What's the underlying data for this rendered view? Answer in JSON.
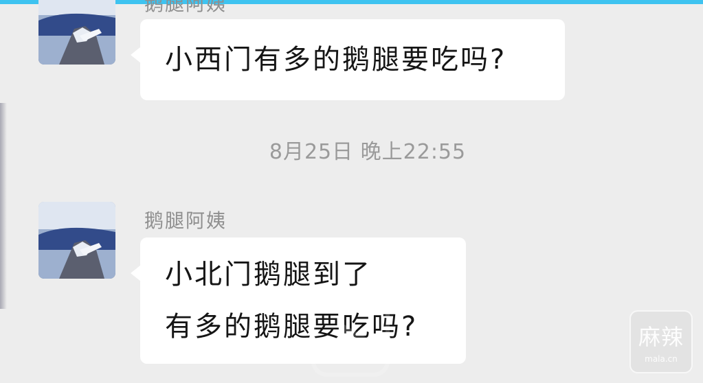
{
  "colors": {
    "background": "#ededed",
    "bubble": "#ffffff",
    "top_strip": "#3ec3f0",
    "name_text": "#8f8f8f",
    "timestamp_text": "#9a9a9a"
  },
  "messages": [
    {
      "sender": "鹅腿阿姨",
      "avatar_icon": "profile-photo-icon",
      "lines": [
        "小西门有多的鹅腿要吃吗?"
      ]
    },
    {
      "sender": "鹅腿阿姨",
      "avatar_icon": "profile-photo-icon",
      "lines": [
        "小北门鹅腿到了",
        "有多的鹅腿要吃吗?"
      ]
    }
  ],
  "timestamp": "8月25日 晚上22:55",
  "overlay": {
    "play_icon": "play-icon"
  },
  "watermark": {
    "main": "麻辣",
    "sub": "mala.cn"
  }
}
